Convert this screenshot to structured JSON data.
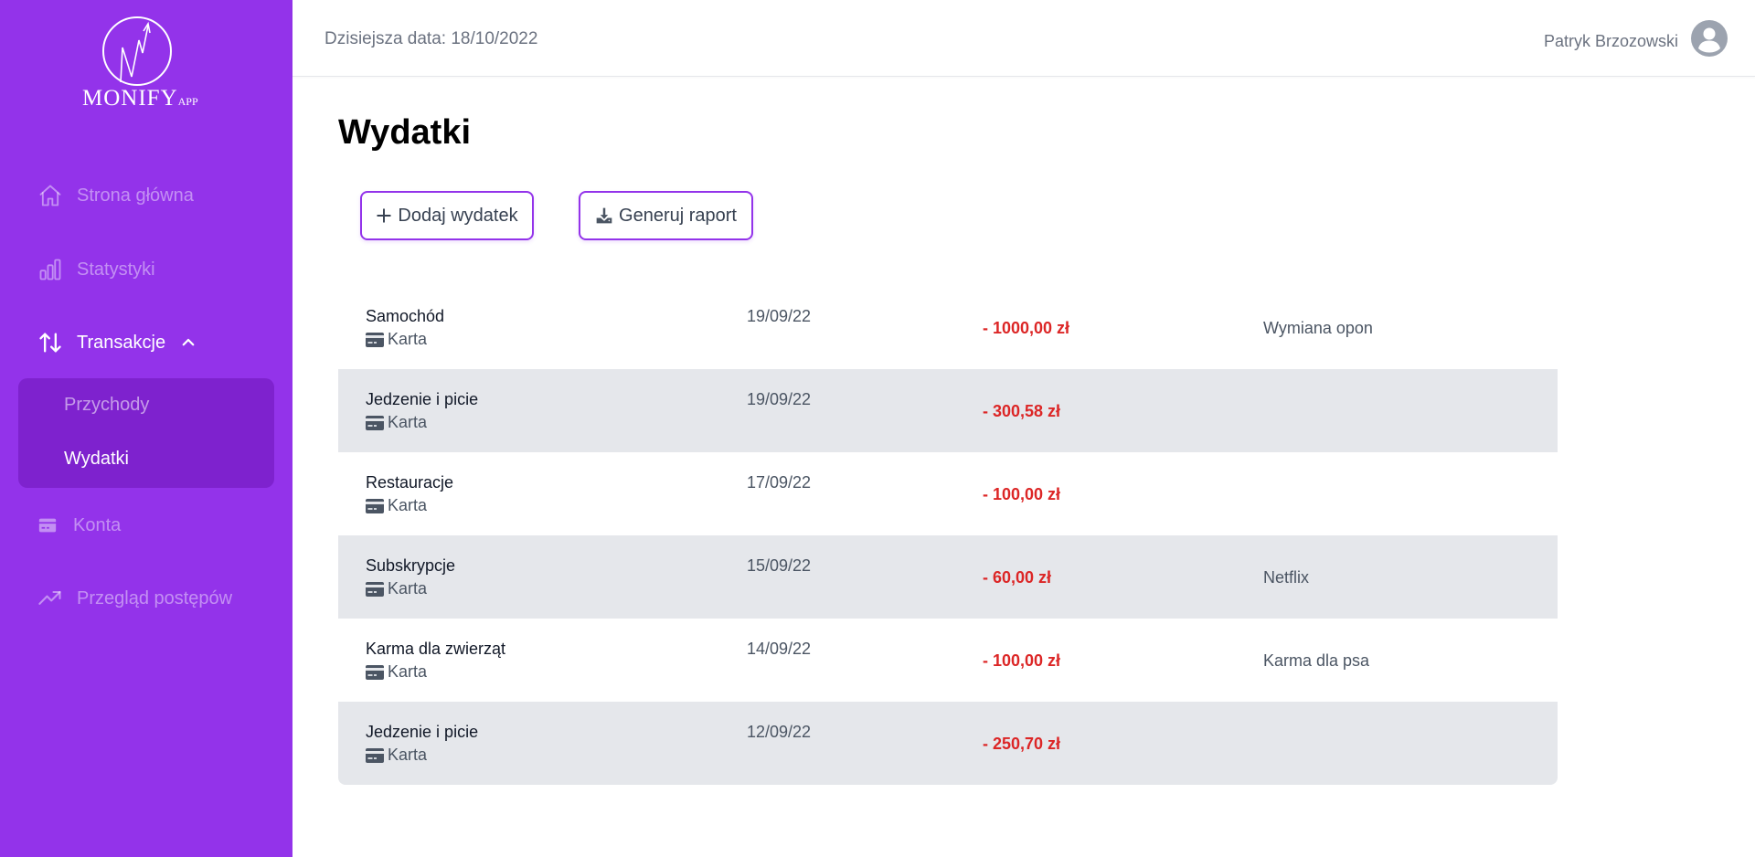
{
  "brand": {
    "name": "MONIFY",
    "suffix": "APP"
  },
  "sidebar": {
    "items": [
      {
        "label": "Strona główna",
        "icon": "home-icon"
      },
      {
        "label": "Statystyki",
        "icon": "bar-chart-icon"
      },
      {
        "label": "Transakcje",
        "icon": "arrows-up-down-icon",
        "expanded": true
      },
      {
        "label": "Konta",
        "icon": "credit-card-icon"
      },
      {
        "label": "Przegląd postępów",
        "icon": "trending-up-icon"
      }
    ],
    "submenu": [
      {
        "label": "Przychody"
      },
      {
        "label": "Wydatki",
        "active": true
      }
    ]
  },
  "header": {
    "date_text": "Dzisiejsza data: 18/10/2022",
    "user_name": "Patryk Brzozowski"
  },
  "main": {
    "title": "Wydatki",
    "add_label": "Dodaj wydatek",
    "report_label": "Generuj raport"
  },
  "transactions": [
    {
      "category": "Samochód",
      "account": "Karta",
      "date": "19/09/22",
      "amount": "- 1000,00 zł",
      "note": "Wymiana opon"
    },
    {
      "category": "Jedzenie i picie",
      "account": "Karta",
      "date": "19/09/22",
      "amount": "- 300,58 zł",
      "note": ""
    },
    {
      "category": "Restauracje",
      "account": "Karta",
      "date": "17/09/22",
      "amount": "- 100,00 zł",
      "note": ""
    },
    {
      "category": "Subskrypcje",
      "account": "Karta",
      "date": "15/09/22",
      "amount": "- 60,00 zł",
      "note": "Netflix"
    },
    {
      "category": "Karma dla zwierząt",
      "account": "Karta",
      "date": "14/09/22",
      "amount": "- 100,00 zł",
      "note": "Karma dla psa"
    },
    {
      "category": "Jedzenie i picie",
      "account": "Karta",
      "date": "12/09/22",
      "amount": "- 250,70 zł",
      "note": ""
    }
  ],
  "colors": {
    "sidebar_bg": "#9333ea",
    "submenu_bg": "#7e22ce",
    "accent": "#9333ea",
    "negative_amount": "#dc2626",
    "row_shade": "#e5e7eb"
  }
}
